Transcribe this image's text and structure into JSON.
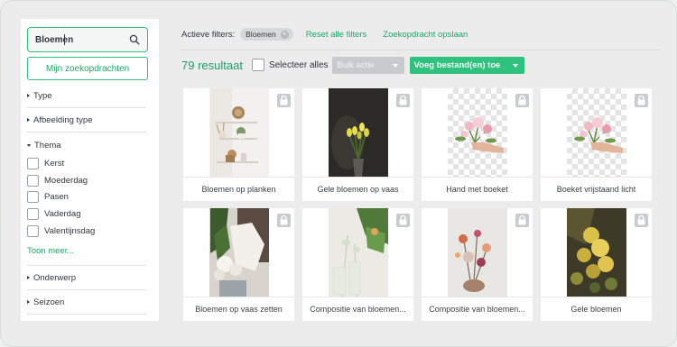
{
  "search": {
    "value": "Bloemen",
    "placeholder": ""
  },
  "sidebar": {
    "my_searches_label": "Mijn zoekopdrachten",
    "facets": [
      {
        "label": "Type"
      },
      {
        "label": "Afbeelding type"
      },
      {
        "label": "Thema"
      },
      {
        "label": "Onderwerp"
      },
      {
        "label": "Seizoen"
      }
    ],
    "theme_options": [
      "Kerst",
      "Moederdag",
      "Pasen",
      "Vaderdag",
      "Valentijnsdag"
    ],
    "show_more_label": "Toon meer..."
  },
  "filters": {
    "label": "Actieve filters:",
    "active_chip": "Bloemen",
    "reset_label": "Reset alle filters",
    "save_label": "Zoekopdracht opslaan"
  },
  "toolbar": {
    "results_count": "79 resultaat",
    "select_all_label": "Selecteer alles",
    "bulk_action_label": "Bulk actie",
    "add_file_label": "Voeg bestand(en) toe"
  },
  "results": [
    {
      "title": "Bloemen op planken"
    },
    {
      "title": "Gele bloemen op vaas"
    },
    {
      "title": "Hand met boeket"
    },
    {
      "title": "Boeket vrijstaand licht"
    },
    {
      "title": "Bloemen op vaas zetten"
    },
    {
      "title": "Compositie van bloemen..."
    },
    {
      "title": "Compositie van bloemen..."
    },
    {
      "title": "Gele bloemen"
    }
  ],
  "colors": {
    "accent": "#2ec27e",
    "accent_text": "#1fa86a",
    "disabled": "#c8cbcc",
    "background": "#ececec"
  }
}
